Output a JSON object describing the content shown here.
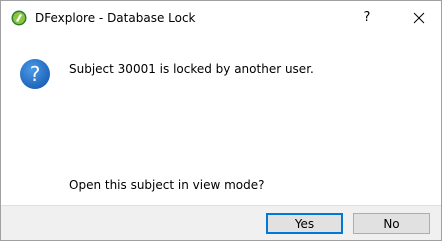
{
  "window": {
    "title": "DFexplore - Database Lock",
    "help_label": "?",
    "app_icon": "dfexplore-app-icon",
    "close_icon": "close-icon"
  },
  "dialog": {
    "icon": "question-icon",
    "message": "Subject 30001 is locked by another user.",
    "question": "Open this subject in view mode?"
  },
  "buttons": {
    "yes_label": "Yes",
    "no_label": "No"
  },
  "colors": {
    "accent": "#0078d7",
    "question_icon": "#1c6bc4",
    "app_icon_fill": "#8cc63f"
  }
}
